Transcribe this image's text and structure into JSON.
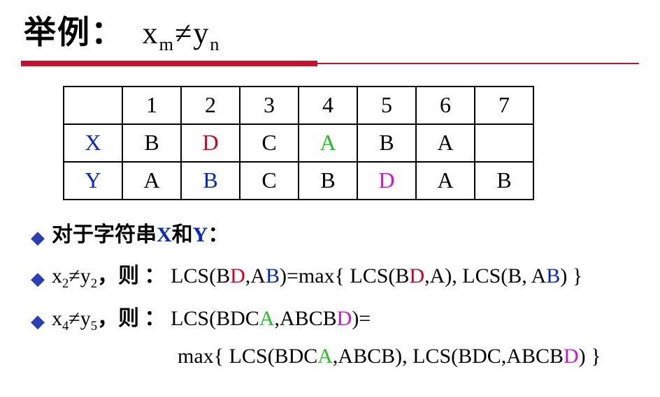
{
  "title_cn": "举例：",
  "title_eq_left": "x",
  "title_eq_sub1": "m",
  "title_eq_neq": "≠",
  "title_eq_right": "y",
  "title_eq_sub2": "n",
  "table": {
    "header": [
      "",
      "1",
      "2",
      "3",
      "4",
      "5",
      "6",
      "7"
    ],
    "rows": [
      {
        "label": "X",
        "cells": [
          {
            "t": "B",
            "c": ""
          },
          {
            "t": "D",
            "c": "red"
          },
          {
            "t": "C",
            "c": ""
          },
          {
            "t": "A",
            "c": "green"
          },
          {
            "t": "B",
            "c": ""
          },
          {
            "t": "A",
            "c": ""
          },
          {
            "t": "",
            "c": ""
          }
        ]
      },
      {
        "label": "Y",
        "cells": [
          {
            "t": "A",
            "c": ""
          },
          {
            "t": "B",
            "c": "blue"
          },
          {
            "t": "C",
            "c": ""
          },
          {
            "t": "B",
            "c": ""
          },
          {
            "t": "D",
            "c": "magenta"
          },
          {
            "t": "A",
            "c": ""
          },
          {
            "t": "B",
            "c": ""
          }
        ]
      }
    ]
  },
  "b1": {
    "pre": "对于字符串",
    "x": "X",
    "mid": "和",
    "y": "Y",
    "tail": "："
  },
  "b2": {
    "sub1": "2",
    "sub2": "2",
    "cn": "，则 ：",
    "pieces": {
      "p0": "LCS(B",
      "p1": "D",
      "p2": ",A",
      "p3": "B",
      "p4": ")=max{ LCS(B",
      "p5": "D",
      "p6": ",A),  LCS(B, A",
      "p7": "B",
      "p8": ") }"
    }
  },
  "b3": {
    "sub1": "4",
    "sub2": "5",
    "cn": "，则 ：",
    "pieces": {
      "p0": "LCS(BDC",
      "p1": "A",
      "p2": ",ABCB",
      "p3": "D",
      "p4": ")="
    }
  },
  "b3b": {
    "p0": "max{ LCS(BDC",
    "p1": "A",
    "p2": ",ABCB),  LCS(BDC,ABCB",
    "p3": "D",
    "p4": ") }"
  }
}
